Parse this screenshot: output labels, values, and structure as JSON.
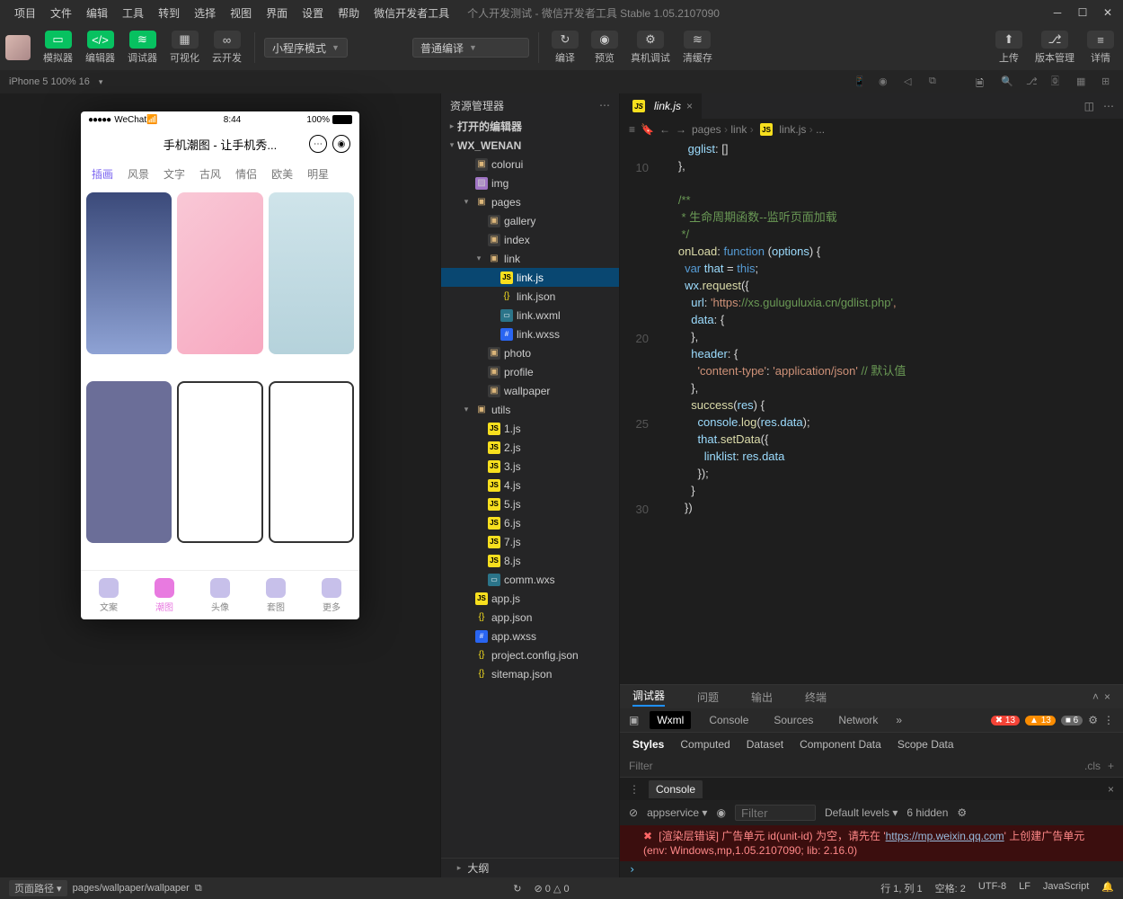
{
  "menu": [
    "项目",
    "文件",
    "编辑",
    "工具",
    "转到",
    "选择",
    "视图",
    "界面",
    "设置",
    "帮助",
    "微信开发者工具"
  ],
  "window_title": "个人开发测试 - 微信开发者工具 Stable 1.05.2107090",
  "toolbar": {
    "simulator": "模拟器",
    "editor": "编辑器",
    "debugger": "调试器",
    "visual": "可视化",
    "cloud": "云开发",
    "mode": "小程序模式",
    "compile_mode": "普通编译",
    "compile": "编译",
    "preview": "预览",
    "remote": "真机调试",
    "clear": "清缓存",
    "upload": "上传",
    "version": "版本管理",
    "detail": "详情"
  },
  "device_bar": {
    "label": "iPhone 5 100% 16",
    "caret": "▾"
  },
  "phone": {
    "carrier": "WeChat",
    "time": "8:44",
    "battery": "100%",
    "title": "手机潮图 - 让手机秀...",
    "tabs": [
      "插画",
      "风景",
      "文字",
      "古风",
      "情侣",
      "欧美",
      "明星"
    ],
    "tabbar": [
      "文案",
      "潮图",
      "头像",
      "套图",
      "更多"
    ]
  },
  "explorer": {
    "title": "资源管理器",
    "open_editors": "打开的编辑器",
    "project": "WX_WENAN",
    "outline": "大纲",
    "tree": [
      {
        "d": 1,
        "t": "folder",
        "n": "colorui"
      },
      {
        "d": 1,
        "t": "img",
        "n": "img"
      },
      {
        "d": 1,
        "t": "folder-open",
        "n": "pages",
        "open": true,
        "children": [
          {
            "d": 2,
            "t": "folder",
            "n": "gallery"
          },
          {
            "d": 2,
            "t": "folder",
            "n": "index"
          },
          {
            "d": 2,
            "t": "folder-open",
            "n": "link",
            "open": true,
            "children": [
              {
                "d": 3,
                "t": "js",
                "n": "link.js",
                "active": true
              },
              {
                "d": 3,
                "t": "json",
                "n": "link.json"
              },
              {
                "d": 3,
                "t": "wxml",
                "n": "link.wxml"
              },
              {
                "d": 3,
                "t": "wxss",
                "n": "link.wxss"
              }
            ]
          },
          {
            "d": 2,
            "t": "folder",
            "n": "photo"
          },
          {
            "d": 2,
            "t": "folder",
            "n": "profile"
          },
          {
            "d": 2,
            "t": "folder",
            "n": "wallpaper"
          }
        ]
      },
      {
        "d": 1,
        "t": "folder-open",
        "n": "utils",
        "open": true,
        "children": [
          {
            "d": 2,
            "t": "js",
            "n": "1.js"
          },
          {
            "d": 2,
            "t": "js",
            "n": "2.js"
          },
          {
            "d": 2,
            "t": "js",
            "n": "3.js"
          },
          {
            "d": 2,
            "t": "js",
            "n": "4.js"
          },
          {
            "d": 2,
            "t": "js",
            "n": "5.js"
          },
          {
            "d": 2,
            "t": "js",
            "n": "6.js"
          },
          {
            "d": 2,
            "t": "js",
            "n": "7.js"
          },
          {
            "d": 2,
            "t": "js",
            "n": "8.js"
          },
          {
            "d": 2,
            "t": "wxml",
            "n": "comm.wxs"
          }
        ]
      },
      {
        "d": 1,
        "t": "js",
        "n": "app.js"
      },
      {
        "d": 1,
        "t": "json",
        "n": "app.json"
      },
      {
        "d": 1,
        "t": "wxss",
        "n": "app.wxss"
      },
      {
        "d": 1,
        "t": "json",
        "n": "project.config.json"
      },
      {
        "d": 1,
        "t": "json",
        "n": "sitemap.json"
      }
    ]
  },
  "editor": {
    "tab": "link.js",
    "breadcrumb": [
      "pages",
      "link",
      "link.js",
      "..."
    ],
    "code_lines": [
      {
        "n": "",
        " ": "      gglist: []"
      },
      {
        "n": "10",
        " ": "   },"
      },
      {
        "n": "",
        " ": ""
      },
      {
        "n": "",
        " ": "   /**"
      },
      {
        "n": "",
        " ": "    * 生命周期函数--监听页面加载"
      },
      {
        "n": "",
        " ": "    */"
      },
      {
        "n": "",
        " ": "   onLoad: function (options) {"
      },
      {
        "n": "",
        " ": "     var that = this;"
      },
      {
        "n": "",
        " ": "     wx.request({"
      },
      {
        "n": "",
        " ": "       url: 'https://xs.guluguluxia.cn/gdlist.php',"
      },
      {
        "n": "",
        " ": "       data: {"
      },
      {
        "n": "20",
        " ": "       },"
      },
      {
        "n": "",
        " ": "       header: {"
      },
      {
        "n": "",
        " ": "         'content-type': 'application/json' // 默认值"
      },
      {
        "n": "",
        " ": "       },"
      },
      {
        "n": "",
        " ": "       success(res) {"
      },
      {
        "n": "25",
        " ": "         console.log(res.data);"
      },
      {
        "n": "",
        " ": "         that.setData({"
      },
      {
        "n": "",
        " ": "           linklist: res.data"
      },
      {
        "n": "",
        " ": "         });"
      },
      {
        "n": "",
        " ": "       }"
      },
      {
        "n": "30",
        " ": "     })"
      }
    ]
  },
  "debugger": {
    "tabs": [
      "调试器",
      "问题",
      "输出",
      "终端"
    ],
    "devtools": [
      "Wxml",
      "Console",
      "Sources",
      "Network"
    ],
    "counts": {
      "err": "13",
      "warn": "13",
      "info": "6"
    },
    "styles_tabs": [
      "Styles",
      "Computed",
      "Dataset",
      "Component Data",
      "Scope Data"
    ],
    "filter": "Filter",
    "cls": ".cls",
    "plus": "+",
    "console_tab": "Console",
    "console_ctx": "appservice",
    "console_filter": "Filter",
    "console_levels": "Default levels",
    "console_hidden": "6 hidden",
    "err_line1_a": "[渲染层错误] 广告单元 id(unit-id) 为空，请先在 '",
    "err_url": "https://mp.weixin.qq.com",
    "err_line1_b": "' 上创建广告单元",
    "err_line2": "(env: Windows,mp,1.05.2107090; lib: 2.16.0)"
  },
  "status": {
    "path_label": "页面路径",
    "path": "pages/wallpaper/wallpaper",
    "circle": "0",
    "tri": "0",
    "line": "行 1, 列 1",
    "spaces": "空格: 2",
    "enc": "UTF-8",
    "eol": "LF",
    "lang": "JavaScript"
  }
}
